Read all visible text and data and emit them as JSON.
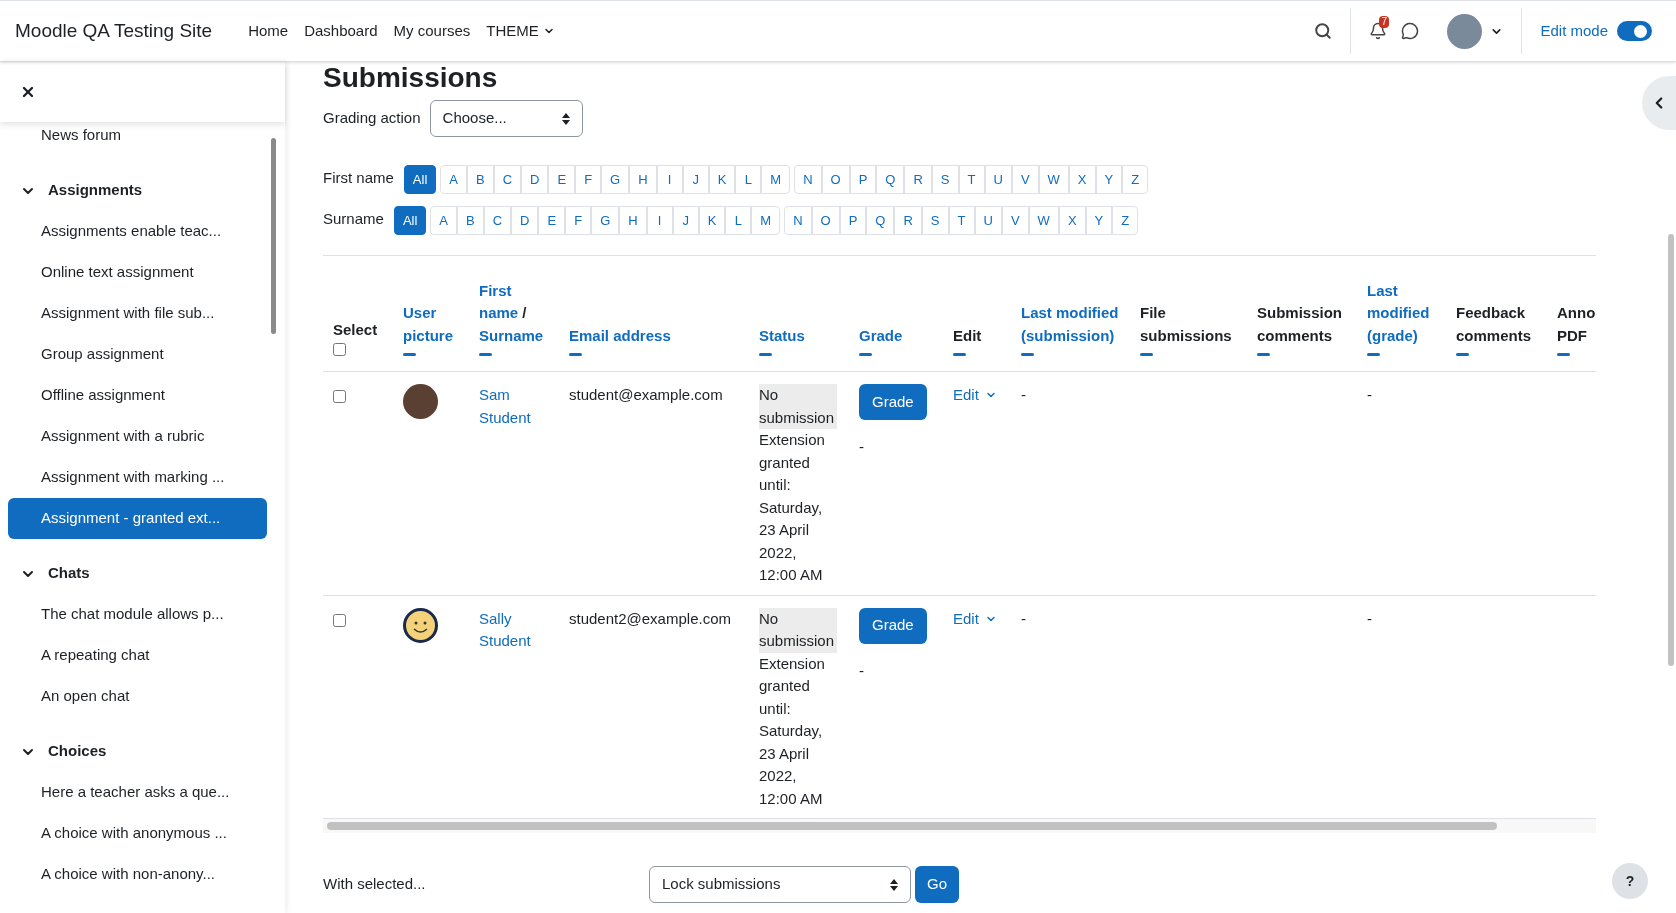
{
  "header": {
    "site_name": "Moodle QA Testing Site",
    "nav": [
      {
        "label": "Home",
        "kind": "link"
      },
      {
        "label": "Dashboard",
        "kind": "link"
      },
      {
        "label": "My courses",
        "kind": "link"
      },
      {
        "label": "THEME",
        "kind": "menu"
      }
    ],
    "notification_count": "7",
    "edit_mode": {
      "label": "Edit mode",
      "on": true
    }
  },
  "sidebar": {
    "items": [
      {
        "label": "News forum",
        "selected": false
      },
      {
        "label": "Assignments",
        "expanded": true,
        "children": [
          {
            "label": "Assignments enable teac...",
            "selected": false
          },
          {
            "label": "Online text assignment",
            "selected": false
          },
          {
            "label": "Assignment with file sub...",
            "selected": false
          },
          {
            "label": "Group assignment",
            "selected": false
          },
          {
            "label": "Offline assignment",
            "selected": false
          },
          {
            "label": "Assignment with a rubric",
            "selected": false
          },
          {
            "label": "Assignment with marking ...",
            "selected": false
          },
          {
            "label": "Assignment - granted ext...",
            "selected": true
          }
        ]
      },
      {
        "label": "Chats",
        "expanded": true,
        "children": [
          {
            "label": "The chat module allows p...",
            "selected": false
          },
          {
            "label": "A repeating chat",
            "selected": false
          },
          {
            "label": "An open chat",
            "selected": false
          }
        ]
      },
      {
        "label": "Choices",
        "expanded": true,
        "children": [
          {
            "label": "Here a teacher asks a que...",
            "selected": false
          },
          {
            "label": "A choice with anonymous ...",
            "selected": false
          },
          {
            "label": "A choice with non-anony...",
            "selected": false
          }
        ]
      }
    ]
  },
  "page_title": "Submissions",
  "grading_action": {
    "label": "Grading action",
    "value": "Choose..."
  },
  "filters": [
    {
      "label": "First name",
      "groups": [
        [
          {
            "label": "All",
            "selected": true
          }
        ],
        [
          {
            "label": "A",
            "selected": false
          },
          {
            "label": "B",
            "selected": false
          },
          {
            "label": "C",
            "selected": false
          },
          {
            "label": "D",
            "selected": false
          },
          {
            "label": "E",
            "selected": false
          },
          {
            "label": "F",
            "selected": false
          },
          {
            "label": "G",
            "selected": false
          },
          {
            "label": "H",
            "selected": false
          },
          {
            "label": "I",
            "selected": false
          },
          {
            "label": "J",
            "selected": false
          },
          {
            "label": "K",
            "selected": false
          },
          {
            "label": "L",
            "selected": false
          },
          {
            "label": "M",
            "selected": false
          }
        ],
        [
          {
            "label": "N",
            "selected": false
          },
          {
            "label": "O",
            "selected": false
          },
          {
            "label": "P",
            "selected": false
          },
          {
            "label": "Q",
            "selected": false
          },
          {
            "label": "R",
            "selected": false
          },
          {
            "label": "S",
            "selected": false
          },
          {
            "label": "T",
            "selected": false
          },
          {
            "label": "U",
            "selected": false
          },
          {
            "label": "V",
            "selected": false
          },
          {
            "label": "W",
            "selected": false
          },
          {
            "label": "X",
            "selected": false
          },
          {
            "label": "Y",
            "selected": false
          },
          {
            "label": "Z",
            "selected": false
          }
        ]
      ]
    },
    {
      "label": "Surname",
      "groups": [
        [
          {
            "label": "All",
            "selected": true
          }
        ],
        [
          {
            "label": "A",
            "selected": false
          },
          {
            "label": "B",
            "selected": false
          },
          {
            "label": "C",
            "selected": false
          },
          {
            "label": "D",
            "selected": false
          },
          {
            "label": "E",
            "selected": false
          },
          {
            "label": "F",
            "selected": false
          },
          {
            "label": "G",
            "selected": false
          },
          {
            "label": "H",
            "selected": false
          },
          {
            "label": "I",
            "selected": false
          },
          {
            "label": "J",
            "selected": false
          },
          {
            "label": "K",
            "selected": false
          },
          {
            "label": "L",
            "selected": false
          },
          {
            "label": "M",
            "selected": false
          }
        ],
        [
          {
            "label": "N",
            "selected": false
          },
          {
            "label": "O",
            "selected": false
          },
          {
            "label": "P",
            "selected": false
          },
          {
            "label": "Q",
            "selected": false
          },
          {
            "label": "R",
            "selected": false
          },
          {
            "label": "S",
            "selected": false
          },
          {
            "label": "T",
            "selected": false
          },
          {
            "label": "U",
            "selected": false
          },
          {
            "label": "V",
            "selected": false
          },
          {
            "label": "W",
            "selected": false
          },
          {
            "label": "X",
            "selected": false
          },
          {
            "label": "Y",
            "selected": false
          },
          {
            "label": "Z",
            "selected": false
          }
        ]
      ]
    }
  ],
  "table": {
    "select_all_checked": false,
    "columns": [
      {
        "labels": [
          "Select"
        ],
        "link": false
      },
      {
        "labels": [
          "User picture"
        ],
        "link": true
      },
      {
        "labels": [
          "First name",
          "Surname"
        ],
        "separator": "/",
        "link": true
      },
      {
        "labels": [
          "Email address"
        ],
        "link": true
      },
      {
        "labels": [
          "Status"
        ],
        "link": true
      },
      {
        "labels": [
          "Grade"
        ],
        "link": true
      },
      {
        "labels": [
          "Edit"
        ],
        "link": false
      },
      {
        "labels": [
          "Last modified (submission)"
        ],
        "link": true
      },
      {
        "labels": [
          "File submissions"
        ],
        "link": false
      },
      {
        "labels": [
          "Submission comments"
        ],
        "link": false
      },
      {
        "labels": [
          "Last modified (grade)"
        ],
        "link": true
      },
      {
        "labels": [
          "Feedback comments"
        ],
        "link": false
      },
      {
        "labels": [
          "Anno PDF"
        ],
        "link": false
      }
    ],
    "rows": [
      {
        "checked": false,
        "avatar": {
          "kind": "photo"
        },
        "name": "Sam Student",
        "email": "student@example.com",
        "status": "No submission",
        "extension": "Extension granted until: Saturday, 23 April 2022, 12:00 AM",
        "grade_button": "Grade",
        "grade": "-",
        "edit": "Edit",
        "last_modified_submission": "-",
        "last_modified_grade": "-"
      },
      {
        "checked": false,
        "avatar": {
          "kind": "smiley"
        },
        "name": "Sally Student",
        "email": "student2@example.com",
        "status": "No submission",
        "extension": "Extension granted until: Saturday, 23 April 2022, 12:00 AM",
        "grade_button": "Grade",
        "grade": "-",
        "edit": "Edit",
        "last_modified_submission": "-",
        "last_modified_grade": "-"
      }
    ]
  },
  "bulk": {
    "label": "With selected...",
    "value": "Lock submissions",
    "button": "Go"
  },
  "help_button": "?"
}
